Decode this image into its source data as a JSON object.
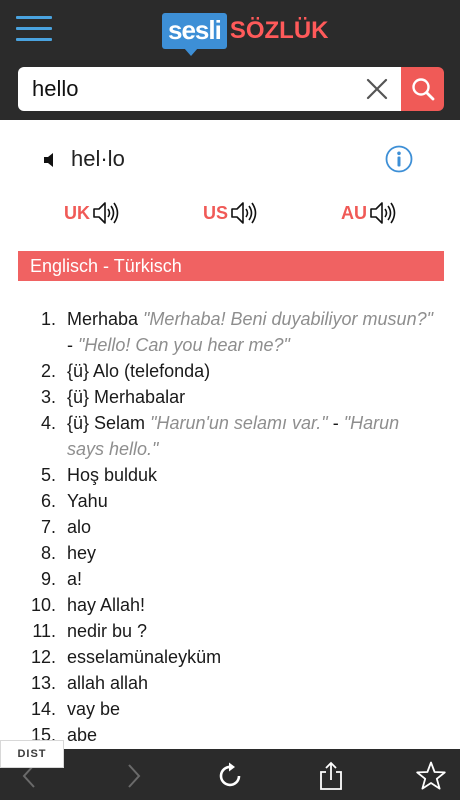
{
  "header": {
    "logo_box": "sesli",
    "logo_text": "SÖZLÜK"
  },
  "search": {
    "value": "hello"
  },
  "word": {
    "syllables": "hel·lo"
  },
  "accents": [
    {
      "label": "UK"
    },
    {
      "label": "US"
    },
    {
      "label": "AU"
    }
  ],
  "section": {
    "title": "Englisch - Türkisch"
  },
  "entries": [
    {
      "num": "1.",
      "text": "Merhaba ",
      "example": "\"Merhaba! Beni duyabiliyor musun?\"",
      "sep": " - ",
      "translation": "\"Hello! Can you hear me?\""
    },
    {
      "num": "2.",
      "text": "{ü} Alo (telefonda)"
    },
    {
      "num": "3.",
      "text": "{ü} Merhabalar"
    },
    {
      "num": "4.",
      "text": "{ü} Selam ",
      "example": "\"Harun'un selamı var.\"",
      "sep": " - ",
      "translation": "\"Harun says hello.\""
    },
    {
      "num": "5.",
      "text": "Hoş bulduk"
    },
    {
      "num": "6.",
      "text": "Yahu"
    },
    {
      "num": "7.",
      "text": "alo"
    },
    {
      "num": "8.",
      "text": "hey"
    },
    {
      "num": "9.",
      "text": "a!"
    },
    {
      "num": "10.",
      "text": "hay Allah!"
    },
    {
      "num": "11.",
      "text": "nedir bu ?"
    },
    {
      "num": "12.",
      "text": "esselamünaleyküm"
    },
    {
      "num": "13.",
      "text": "allah allah"
    },
    {
      "num": "14.",
      "text": "vay be"
    },
    {
      "num": "15.",
      "text": "abe"
    }
  ],
  "badge": {
    "text": "DIST"
  },
  "colors": {
    "bar_dark": "#2b2b2b",
    "accent_red": "#f05a57",
    "logo_blue": "#3d8fd6",
    "menu_blue": "#4aa3df",
    "example_gray": "#8e8e8e"
  },
  "icons": [
    "menu-icon",
    "close-icon",
    "search-icon",
    "speaker-icon",
    "info-icon",
    "back-arrow-icon",
    "forward-arrow-icon",
    "reload-icon",
    "share-icon",
    "star-icon"
  ]
}
